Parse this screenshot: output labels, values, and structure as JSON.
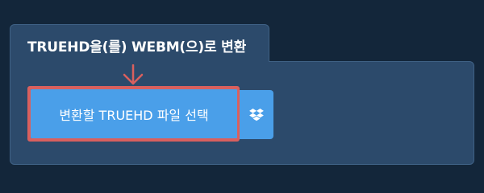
{
  "panel": {
    "title": "TRUEHD을(를) WEBM(으)로 변환"
  },
  "buttons": {
    "choose_file_label": "변환할 TRUEHD 파일 선택",
    "dropbox_icon": "dropbox-icon"
  },
  "colors": {
    "page_background": "#13263a",
    "panel": "#2c4a6b",
    "button": "#4a9fe9",
    "highlight": "#d9605e"
  }
}
